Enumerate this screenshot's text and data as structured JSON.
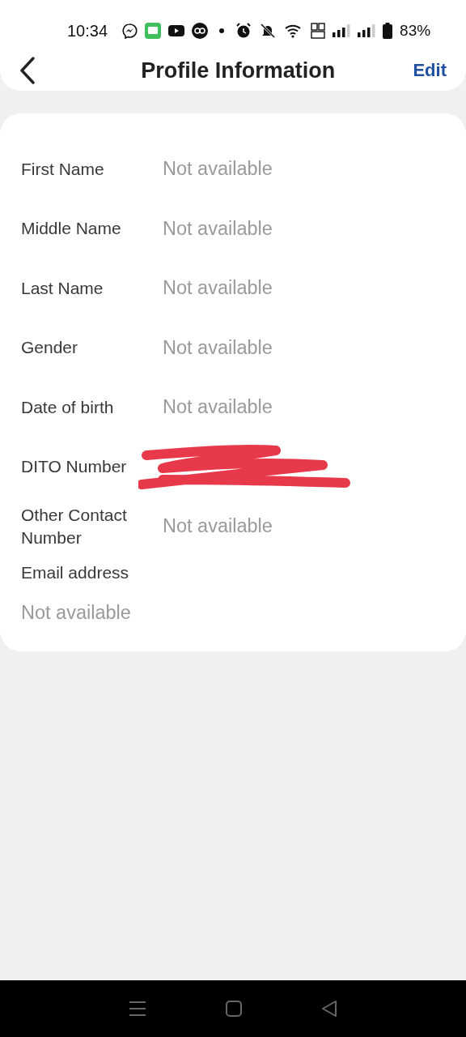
{
  "status_bar": {
    "time": "10:34",
    "battery": "83%"
  },
  "header": {
    "title": "Profile Information",
    "action": "Edit"
  },
  "fields": [
    {
      "label": "First Name",
      "value": "Not available",
      "kind": "inline"
    },
    {
      "label": "Middle Name",
      "value": "Not available",
      "kind": "inline"
    },
    {
      "label": "Last Name",
      "value": "Not available",
      "kind": "inline"
    },
    {
      "label": "Gender",
      "value": "Not available",
      "kind": "inline"
    },
    {
      "label": "Date of birth",
      "value": "Not available",
      "kind": "inline"
    },
    {
      "label": "DITO Number",
      "kind": "redacted"
    },
    {
      "label": "Other Contact Number",
      "value": "Not available",
      "kind": "inline"
    },
    {
      "label": "Email address",
      "value": "Not available",
      "kind": "stacked"
    }
  ]
}
